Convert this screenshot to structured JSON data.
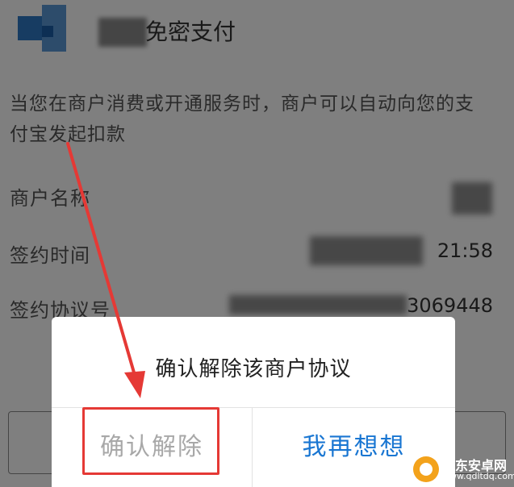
{
  "header": {
    "title": "免密支付"
  },
  "description": "当您在商户消费或开通服务时，商户可以自动向您的支付宝发起扣款",
  "rows": [
    {
      "label": "商户名称",
      "value": ""
    },
    {
      "label": "签约时间",
      "value": "21:58"
    },
    {
      "label": "签约协议号",
      "value": "3069448"
    }
  ],
  "dialog": {
    "message": "确认解除该商户协议",
    "confirm_label": "确认解除",
    "cancel_label": "我再想想"
  },
  "watermark": {
    "brand": "启东安卓网",
    "url": "www.qdltdq.com"
  },
  "colors": {
    "accent": "#1976d2",
    "highlight": "#e53935",
    "arrow": "#e53935"
  }
}
